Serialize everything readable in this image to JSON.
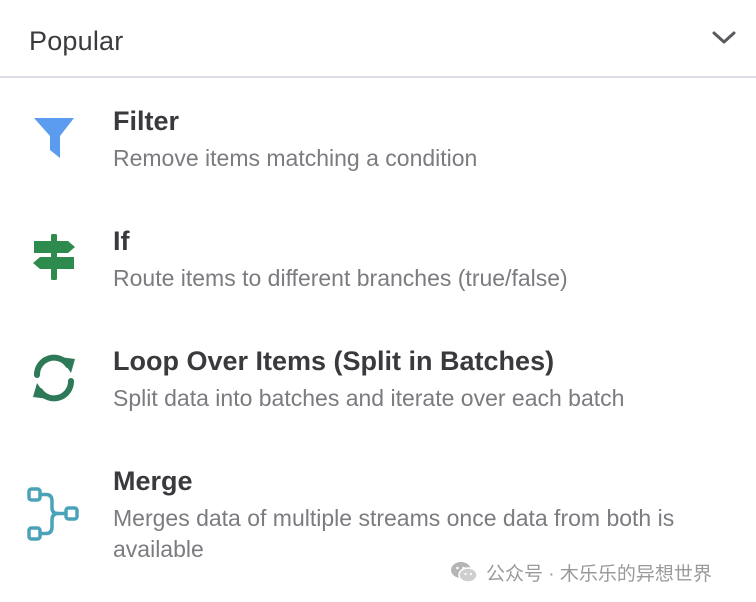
{
  "section": {
    "title": "Popular",
    "toggle_icon": "chevron-down-icon"
  },
  "nodes": [
    {
      "icon": "filter-icon",
      "icon_color": "#5b9cf0",
      "title": "Filter",
      "description": "Remove items matching a condition"
    },
    {
      "icon": "signpost-icon",
      "icon_color": "#2e8b4e",
      "title": "If",
      "description": "Route items to different branches (true/false)"
    },
    {
      "icon": "loop-arrows-icon",
      "icon_color": "#2e7a58",
      "title": "Loop Over Items (Split in Batches)",
      "description": "Split data into batches and iterate over each batch"
    },
    {
      "icon": "merge-icon",
      "icon_color": "#4aa3b8",
      "title": "Merge",
      "description": "Merges data of multiple streams once data from both is available"
    }
  ],
  "watermark": {
    "icon": "wechat-icon",
    "text": "公众号 · 木乐乐的异想世界"
  }
}
